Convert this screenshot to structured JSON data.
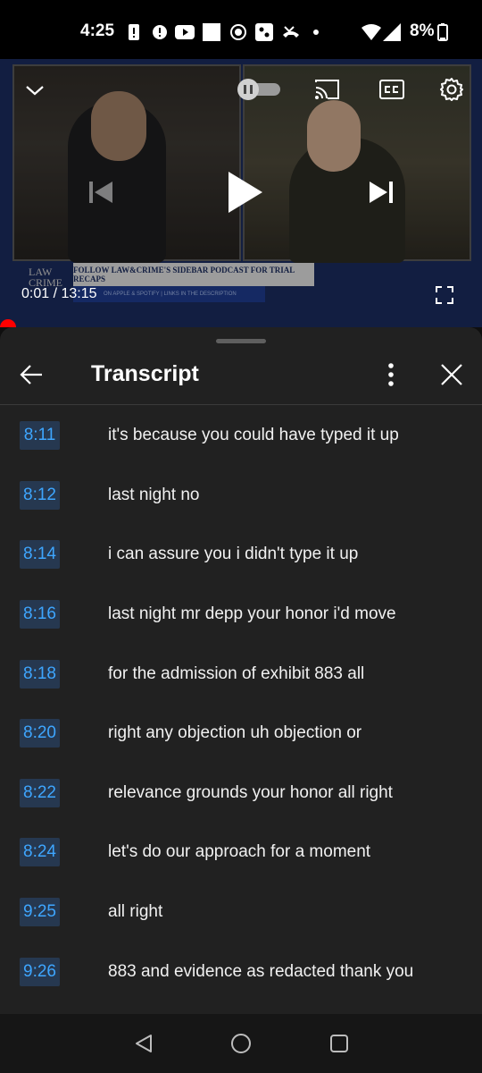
{
  "status_bar": {
    "time": "4:25",
    "battery_percent": "8%"
  },
  "player": {
    "banner_text": "FOLLOW LAW&CRIME'S SIDEBAR PODCAST FOR TRIAL RECAPS",
    "banner_subtext": "ON APPLE & SPOTIFY | LINKS IN THE DESCRIPTION",
    "logo_line1": "LAW",
    "logo_line2": "CRIME",
    "current_time": "0:01",
    "separator": "/",
    "duration": "13:15",
    "autoplay_state": "paused",
    "progress": 0.0013
  },
  "panel": {
    "title": "Transcript"
  },
  "transcript": [
    {
      "ts": "8:11",
      "text": "it's because you could have typed it up"
    },
    {
      "ts": "8:12",
      "text": "last night no"
    },
    {
      "ts": "8:14",
      "text": "i can assure you i didn't type it up"
    },
    {
      "ts": "8:16",
      "text": "last night mr depp your honor i'd move"
    },
    {
      "ts": "8:18",
      "text": "for the admission of exhibit 883 all"
    },
    {
      "ts": "8:20",
      "text": "right any objection uh objection or"
    },
    {
      "ts": "8:22",
      "text": "relevance grounds your honor all right"
    },
    {
      "ts": "8:24",
      "text": "let's do our approach for a moment"
    },
    {
      "ts": "9:25",
      "text": "all right"
    },
    {
      "ts": "9:26",
      "text": "883 and evidence as redacted thank you"
    }
  ],
  "colors": {
    "timestamp_text": "#3ea6ff",
    "timestamp_bg": "#263850",
    "progress": "#ff0000",
    "panel_bg": "#212121"
  }
}
